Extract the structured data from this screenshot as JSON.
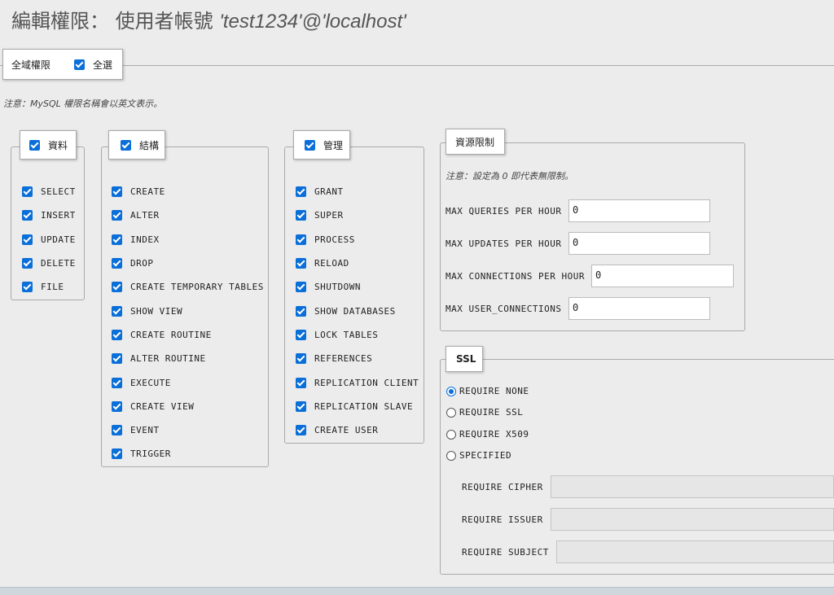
{
  "page_title": "編輯權限： 使用者帳號 ",
  "page_title_account": "'test1234'@'localhost'",
  "global": {
    "legend": "全域權限",
    "select_all_label": "全選",
    "select_all_checked": true
  },
  "note": "注意：MySQL 權限名稱會以英文表示。",
  "groups": {
    "data": {
      "label": "資料",
      "items": [
        "SELECT",
        "INSERT",
        "UPDATE",
        "DELETE",
        "FILE"
      ]
    },
    "structure": {
      "label": "結構",
      "items": [
        "CREATE",
        "ALTER",
        "INDEX",
        "DROP",
        "CREATE TEMPORARY TABLES",
        "SHOW VIEW",
        "CREATE ROUTINE",
        "ALTER ROUTINE",
        "EXECUTE",
        "CREATE VIEW",
        "EVENT",
        "TRIGGER"
      ]
    },
    "admin": {
      "label": "管理",
      "items": [
        "GRANT",
        "SUPER",
        "PROCESS",
        "RELOAD",
        "SHUTDOWN",
        "SHOW DATABASES",
        "LOCK TABLES",
        "REFERENCES",
        "REPLICATION CLIENT",
        "REPLICATION SLAVE",
        "CREATE USER"
      ]
    }
  },
  "resources": {
    "label": "資源限制",
    "note": "注意：設定為 0 即代表無限制。",
    "fields": [
      {
        "label": "MAX QUERIES PER HOUR",
        "value": "0"
      },
      {
        "label": "MAX UPDATES PER HOUR",
        "value": "0"
      },
      {
        "label": "MAX CONNECTIONS PER HOUR",
        "value": "0"
      },
      {
        "label": "MAX USER_CONNECTIONS",
        "value": "0"
      }
    ]
  },
  "ssl": {
    "label": "SSL",
    "options": [
      "REQUIRE NONE",
      "REQUIRE SSL",
      "REQUIRE X509",
      "SPECIFIED"
    ],
    "selected": "REQUIRE NONE",
    "fields": [
      {
        "label": "REQUIRE CIPHER",
        "value": ""
      },
      {
        "label": "REQUIRE ISSUER",
        "value": ""
      },
      {
        "label": "REQUIRE SUBJECT",
        "value": ""
      }
    ]
  },
  "colors": {
    "checkbox_accent": "#0a6fd8",
    "background": "#ececec"
  }
}
